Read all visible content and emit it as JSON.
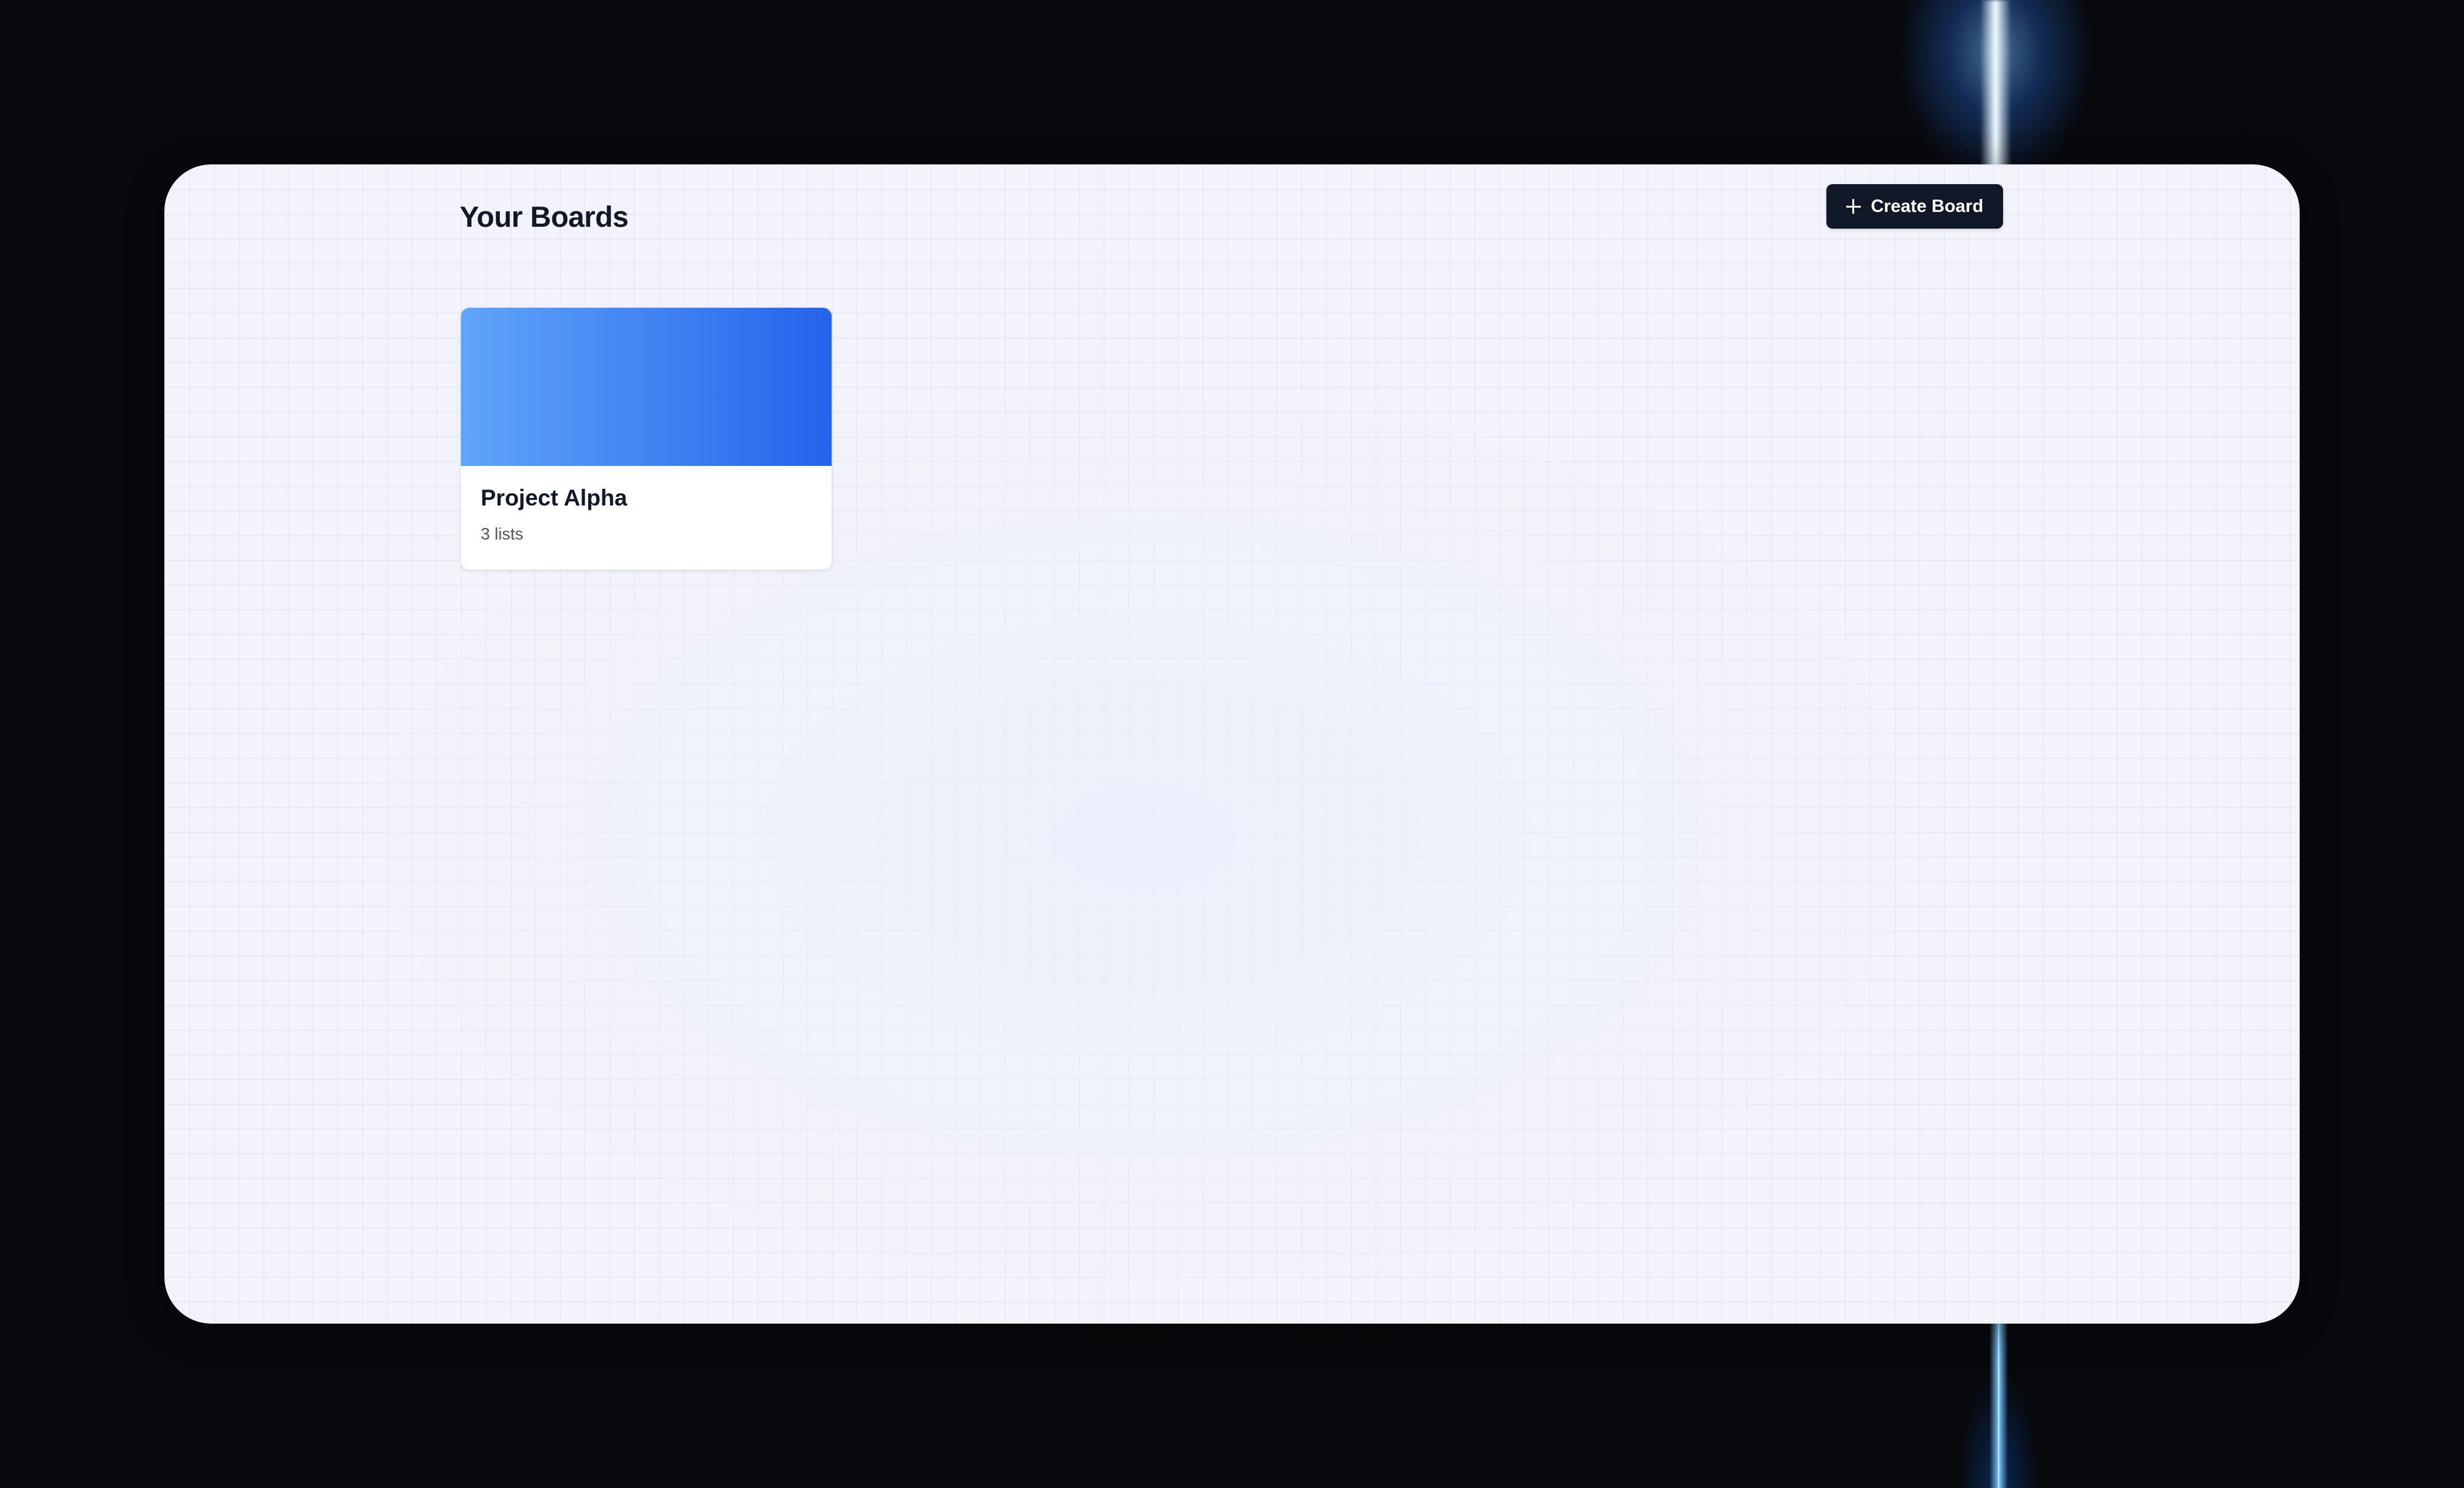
{
  "header": {
    "title": "Your Boards",
    "create_button_label": "Create Board",
    "create_button_icon": "plus-icon"
  },
  "boards": [
    {
      "name": "Project Alpha",
      "meta": "3 lists",
      "cover_gradient": [
        "#60a5fa",
        "#2563eb"
      ]
    }
  ],
  "colors": {
    "page_background": "#f3f3fb",
    "primary_dark": "#111827",
    "backdrop": "#07090d"
  }
}
